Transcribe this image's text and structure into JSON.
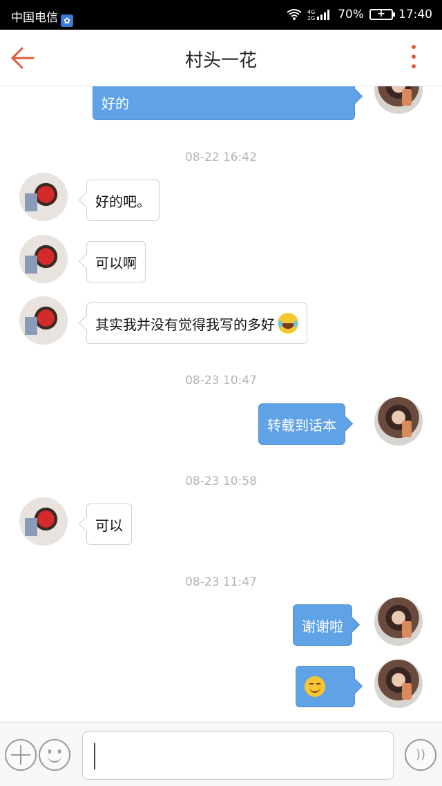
{
  "status_bar": {
    "carrier": "中国电信",
    "network": "4G 2G",
    "battery": "70%",
    "time": "17:40"
  },
  "header": {
    "title": "村头一花"
  },
  "messages": [
    {
      "type": "out",
      "text": "好的"
    },
    {
      "type": "time",
      "text": "08-22 16:42"
    },
    {
      "type": "in",
      "text": "好的吧。"
    },
    {
      "type": "in",
      "text": "可以啊"
    },
    {
      "type": "in",
      "text": "其实我并没有觉得我写的多好",
      "emoji": "laughing-tears-emoji"
    },
    {
      "type": "time",
      "text": "08-23 10:47"
    },
    {
      "type": "out",
      "text": "转载到话本"
    },
    {
      "type": "time",
      "text": "08-23 10:58"
    },
    {
      "type": "in",
      "text": "可以"
    },
    {
      "type": "time",
      "text": "08-23 11:47"
    },
    {
      "type": "out",
      "text": "谢谢啦"
    },
    {
      "type": "out",
      "text": "",
      "emoji": "smile-emoji"
    }
  ],
  "input": {
    "value": "",
    "placeholder": ""
  },
  "colors": {
    "accent": "#e05a3a",
    "outgoing_bubble": "#5fa3e6",
    "timestamp": "#b3b3b3"
  }
}
